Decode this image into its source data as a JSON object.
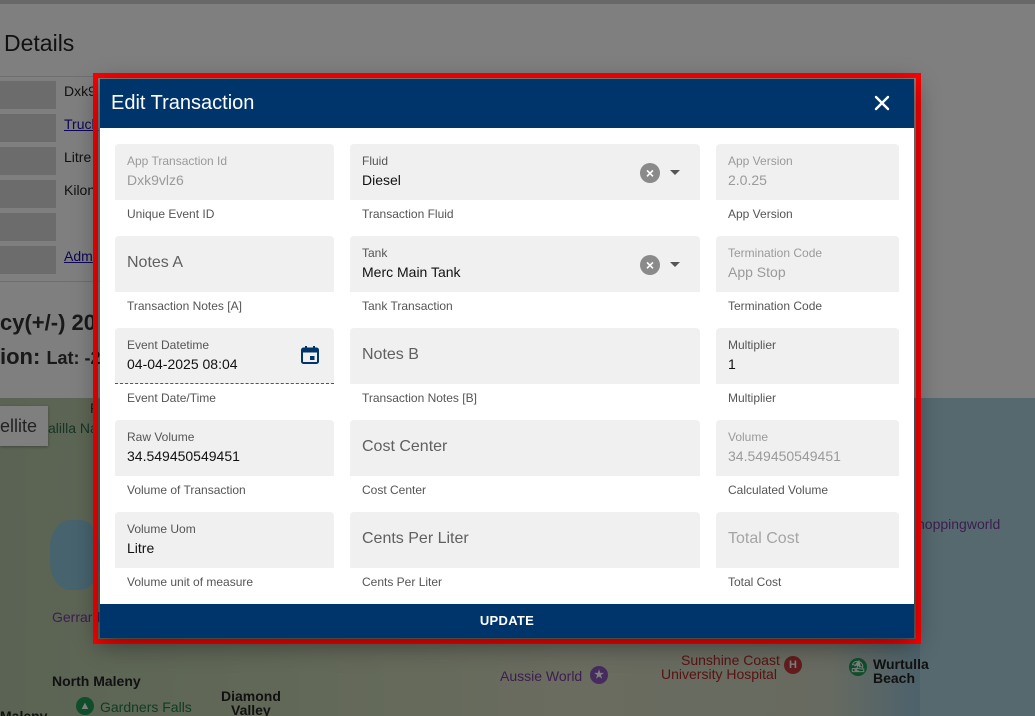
{
  "background": {
    "page_title": "Details",
    "rows": [
      "Dxk9",
      "Truck",
      "Litre",
      "Kilon",
      "",
      "Adm"
    ],
    "accuracy_text": "cy(+/-) 20",
    "location_text": "ion:",
    "location_small": "Lat: -2",
    "map_toggle": "ellite",
    "map_labels": {
      "lalilla": "alilla Na",
      "f": "F",
      "gerrard": "Gerrard",
      "north_maleny": "North Maleny",
      "gardners_falls": "Gardners Falls",
      "diamond_valley_1": "Diamond",
      "diamond_valley_2": "Valley",
      "aussie_world": "Aussie World",
      "sunshine_coast_1": "Sunshine Coast",
      "sunshine_coast_2": "University Hospital",
      "wurtulla_1": "Wurtulla",
      "wurtulla_2": "Beach",
      "shoppingworld": "hoppingworld",
      "maleny": "Maleny"
    }
  },
  "modal": {
    "title": "Edit Transaction",
    "update_label": "UPDATE",
    "fields": {
      "app_transaction_id": {
        "label": "App Transaction Id",
        "value": "Dxk9vlz6",
        "hint": "Unique Event ID"
      },
      "fluid": {
        "label": "Fluid",
        "value": "Diesel",
        "hint": "Transaction Fluid"
      },
      "app_version": {
        "label": "App Version",
        "value": "2.0.25",
        "hint": "App Version"
      },
      "notes_a": {
        "placeholder": "Notes A",
        "hint": "Transaction Notes [A]"
      },
      "tank": {
        "label": "Tank",
        "value": "Merc Main Tank",
        "hint": "Tank Transaction"
      },
      "termination_code": {
        "label": "Termination Code",
        "value": "App Stop",
        "hint": "Termination Code"
      },
      "event_datetime": {
        "label": "Event Datetime",
        "value": "04-04-2025 08:04",
        "hint": "Event Date/Time"
      },
      "notes_b": {
        "placeholder": "Notes B",
        "hint": "Transaction Notes [B]"
      },
      "multiplier": {
        "label": "Multiplier",
        "value": "1",
        "hint": "Multiplier"
      },
      "raw_volume": {
        "label": "Raw Volume",
        "value": "34.549450549451",
        "hint": "Volume of Transaction"
      },
      "cost_center": {
        "placeholder": "Cost Center",
        "hint": "Cost Center"
      },
      "volume": {
        "label": "Volume",
        "value": "34.549450549451",
        "hint": "Calculated Volume"
      },
      "volume_uom": {
        "label": "Volume Uom",
        "value": "Litre",
        "hint": "Volume unit of measure"
      },
      "cents_per_liter": {
        "placeholder": "Cents Per Liter",
        "hint": "Cents Per Liter"
      },
      "total_cost": {
        "placeholder": "Total Cost",
        "hint": "Total Cost"
      }
    }
  },
  "colors": {
    "header": "#00356b",
    "highlight": "#ff0000",
    "field_bg": "#f0f0f0"
  },
  "icons": {
    "close": "close-icon",
    "clear": "clear-icon",
    "dropdown": "chevron-down-icon",
    "calendar": "calendar-icon"
  }
}
